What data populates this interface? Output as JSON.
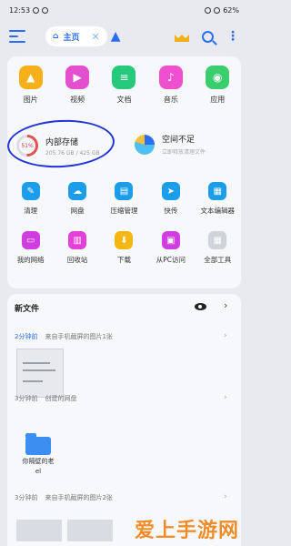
{
  "status": {
    "time": "12:53",
    "battery": "62%"
  },
  "topbar": {
    "tab_label": "主页"
  },
  "categories": [
    {
      "label": "图片",
      "color": "#f6b01b",
      "icon": "image-icon"
    },
    {
      "label": "视频",
      "color": "#e44fd0",
      "icon": "video-icon"
    },
    {
      "label": "文档",
      "color": "#27c97c",
      "icon": "document-icon"
    },
    {
      "label": "音乐",
      "color": "#ef4fcf",
      "icon": "music-icon"
    },
    {
      "label": "应用",
      "color": "#3ccd6e",
      "icon": "android-icon"
    }
  ],
  "storage": {
    "title": "内部存储",
    "percent": "51%",
    "detail": "205.76 GB / 425 GB",
    "percent_value": 51
  },
  "space": {
    "title": "空间不足",
    "subtitle": "立即释放清理文件"
  },
  "tools_row1": [
    {
      "label": "清理",
      "color": "#1b9dea",
      "icon": "broom-icon"
    },
    {
      "label": "网盘",
      "color": "#1b9dea",
      "icon": "cloud-icon"
    },
    {
      "label": "压缩管理",
      "color": "#1b9dea",
      "icon": "zip-icon"
    },
    {
      "label": "快传",
      "color": "#1b9dea",
      "icon": "send-icon"
    },
    {
      "label": "文本编辑器",
      "color": "#1b9dea",
      "icon": "text-editor-icon"
    }
  ],
  "tools_row2": [
    {
      "label": "我的网络",
      "color": "#d03de0",
      "icon": "router-icon"
    },
    {
      "label": "回收站",
      "color": "#e43fd6",
      "icon": "trash-icon"
    },
    {
      "label": "下载",
      "color": "#f3b816",
      "icon": "download-icon"
    },
    {
      "label": "从PC访问",
      "color": "#d03de0",
      "icon": "pc-icon"
    },
    {
      "label": "全部工具",
      "color": "#cfd3da",
      "icon": "grid-icon"
    }
  ],
  "recent": {
    "title": "新文件",
    "groups": [
      {
        "time": "2分钟前",
        "desc": "来自手机截屏的图片1张"
      },
      {
        "time": "3分钟前",
        "desc": "创建的网盘",
        "file": "你隔壁的老el"
      },
      {
        "time": "3分钟前",
        "desc": "来自手机截屏的图片2张"
      }
    ]
  },
  "watermark": "爱上手游网"
}
